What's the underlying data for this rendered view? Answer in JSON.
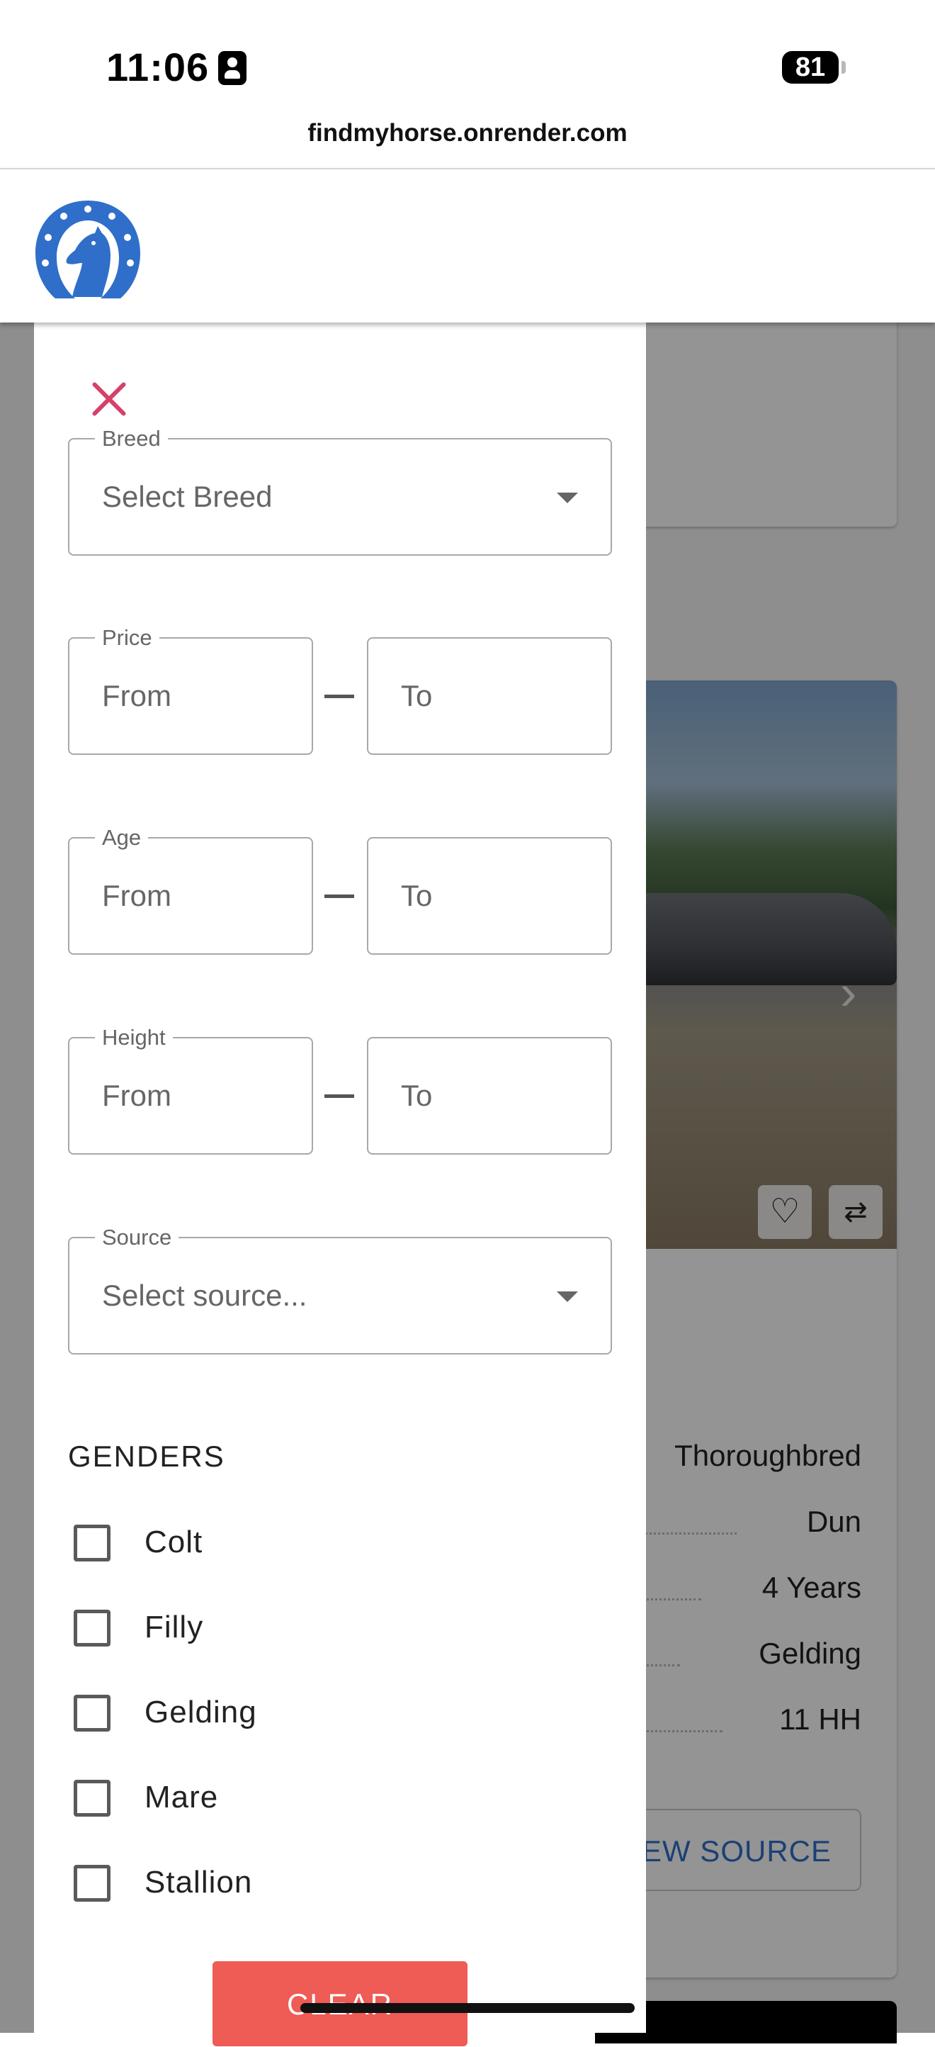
{
  "status_bar": {
    "time": "11:06",
    "battery": "81"
  },
  "browser": {
    "url": "findmyhorse.onrender.com"
  },
  "filters": {
    "breed": {
      "legend": "Breed",
      "placeholder": "Select Breed"
    },
    "price": {
      "legend": "Price",
      "from_placeholder": "From",
      "to_placeholder": "To"
    },
    "age": {
      "legend": "Age",
      "from_placeholder": "From",
      "to_placeholder": "To"
    },
    "height": {
      "legend": "Height",
      "from_placeholder": "From",
      "to_placeholder": "To"
    },
    "source": {
      "legend": "Source",
      "placeholder": "Select source..."
    },
    "genders": {
      "title": "GENDERS",
      "options": [
        {
          "label": "Colt",
          "checked": false
        },
        {
          "label": "Filly",
          "checked": false
        },
        {
          "label": "Gelding",
          "checked": false
        },
        {
          "label": "Mare",
          "checked": false
        },
        {
          "label": "Stallion",
          "checked": false
        }
      ]
    },
    "clear_label": "CLEAR"
  },
  "background_listing": {
    "specs": [
      "Thoroughbred",
      "Dun",
      "4 Years",
      "Gelding",
      "11 HH"
    ],
    "view_source_label": "VIEW SOURCE"
  },
  "colors": {
    "brand_blue": "#2f6fc9",
    "close_accent": "#d6416a",
    "clear_button": "#ef5b55"
  }
}
